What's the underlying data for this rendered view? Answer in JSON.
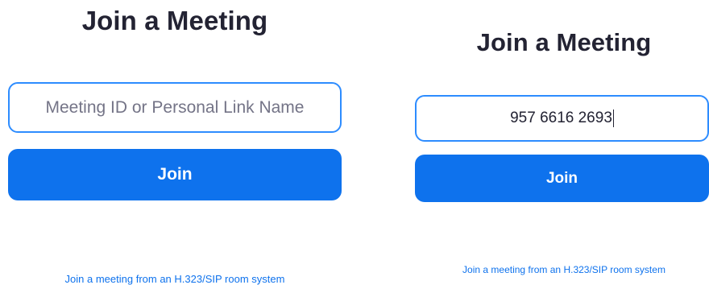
{
  "left_panel": {
    "title": "Join a Meeting",
    "meeting_input": {
      "value": "",
      "placeholder": "Meeting ID or Personal Link Name"
    },
    "join_label": "Join",
    "sip_link": "Join a meeting from an H.323/SIP room system"
  },
  "right_panel": {
    "title": "Join a Meeting",
    "meeting_input": {
      "value": "957 6616 2693",
      "placeholder": ""
    },
    "join_label": "Join",
    "sip_link": "Join a meeting from an H.323/SIP room system"
  },
  "colors": {
    "accent": "#0e72ed",
    "input_border": "#2d8cff",
    "title_text": "#232333",
    "placeholder_text": "#747487"
  }
}
